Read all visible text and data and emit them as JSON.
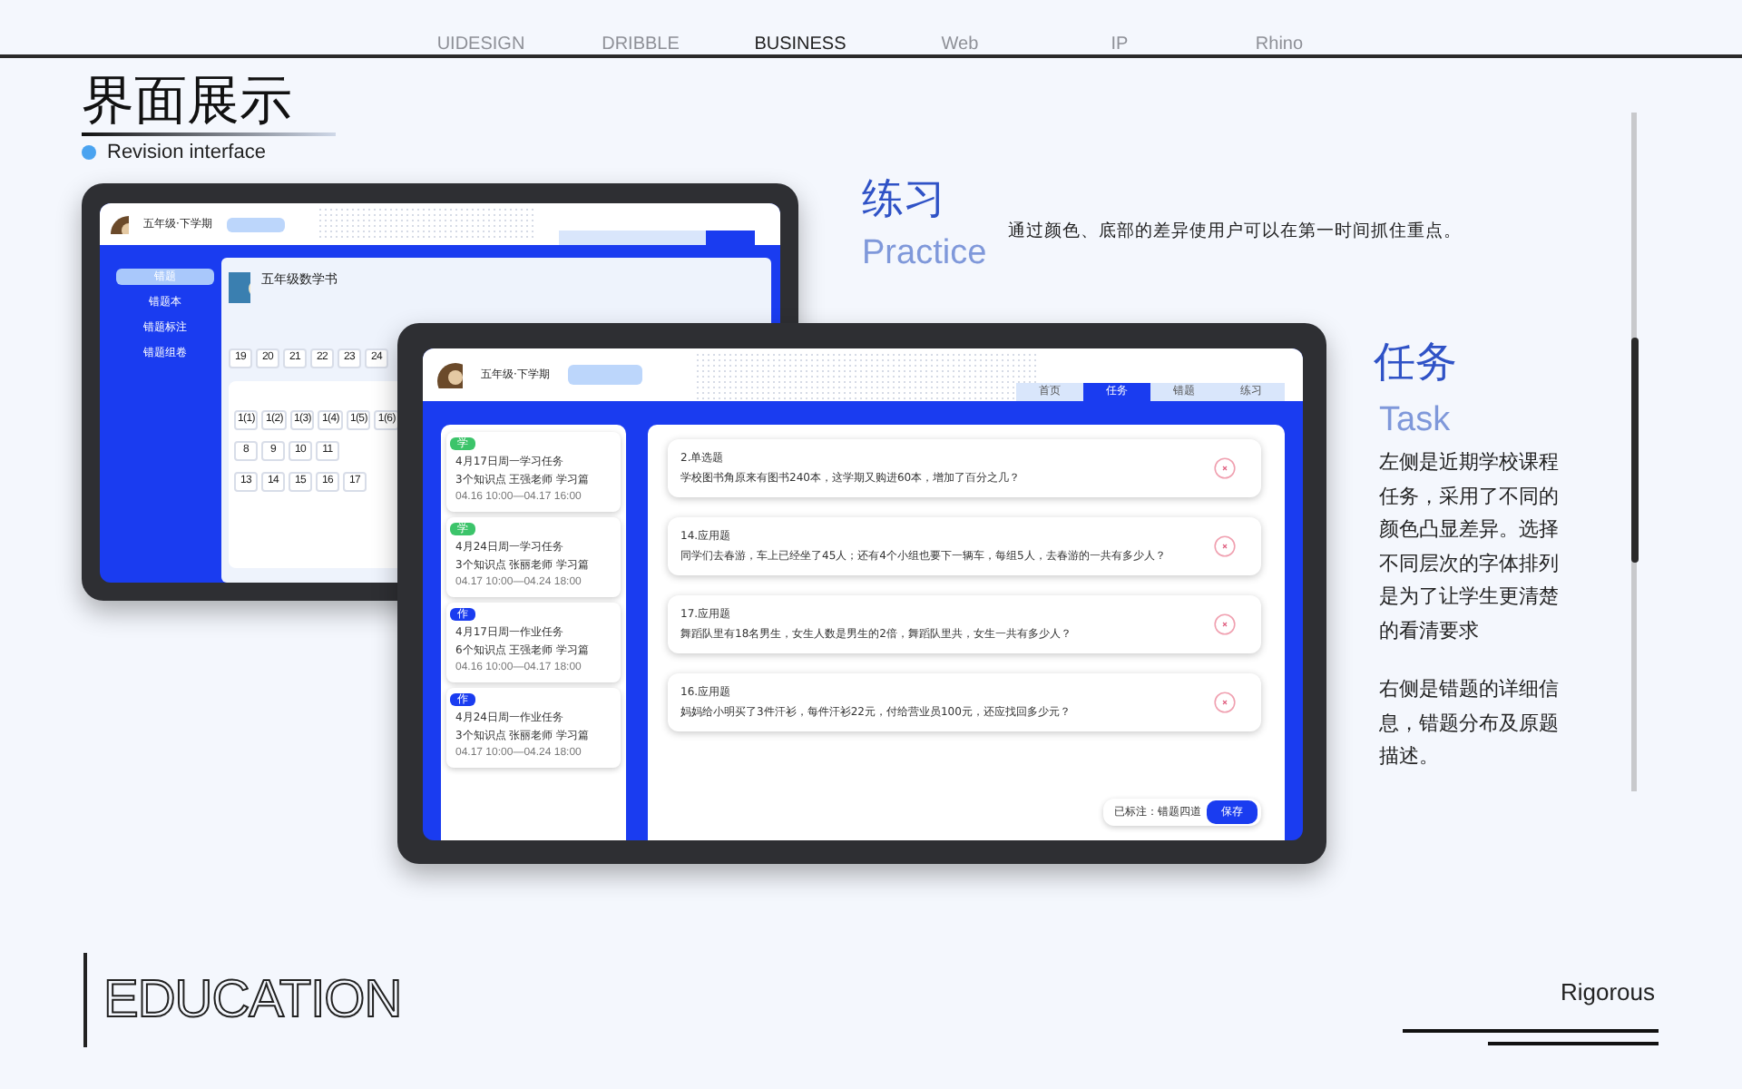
{
  "nav": [
    {
      "label": "UIDESIGN",
      "selected": false
    },
    {
      "label": "DRIBBLE",
      "selected": false
    },
    {
      "label": "BUSINESS",
      "selected": true
    },
    {
      "label": "Web",
      "selected": false
    },
    {
      "label": "IP",
      "selected": false
    },
    {
      "label": "Rhino",
      "selected": false
    }
  ],
  "title": "界面展示",
  "subtitle": "Revision interface",
  "practice": {
    "title": "练习",
    "subtitle": "Practice",
    "description": "通过颜色、底部的差异使用户可以在第一时间抓住重点。"
  },
  "task": {
    "title": "任务",
    "subtitle": "Task",
    "paragraphs": [
      "左侧是近期学校课程任务，采用了不同的颜色凸显差异。选择不同层次的字体排列是为了让学生更清楚的看清要求",
      "右侧是错题的详细信息，错题分布及原题描述。"
    ]
  },
  "back_tablet": {
    "term": "五年级·下学期",
    "sidebar": [
      {
        "label": "错题",
        "selected": true
      },
      {
        "label": "错题本",
        "selected": false
      },
      {
        "label": "错题标注",
        "selected": false
      },
      {
        "label": "错题组卷",
        "selected": false
      }
    ],
    "tabs": [
      {
        "selected": false
      },
      {
        "selected": false
      },
      {
        "selected": false
      },
      {
        "selected": true
      }
    ],
    "book_title": "五年级数学书",
    "chip_rows": [
      [
        "19",
        "20",
        "21",
        "22",
        "23",
        "24"
      ],
      [
        "1(1)",
        "1(2)",
        "1(3)",
        "1(4)",
        "1(5)",
        "1(6)"
      ],
      [
        "8",
        "9",
        "10",
        "11"
      ],
      [
        "13",
        "14",
        "15",
        "16",
        "17"
      ]
    ]
  },
  "front_tablet": {
    "term": "五年级·下学期",
    "tabs": [
      {
        "label": "首页",
        "selected": false
      },
      {
        "label": "任务",
        "selected": true
      },
      {
        "label": "错题",
        "selected": false
      },
      {
        "label": "练习",
        "selected": false
      }
    ],
    "tasks": [
      {
        "tag": "学",
        "color": "#3cc46a",
        "title": "4月17日周一学习任务",
        "meta": "3个知识点 王强老师 学习篇",
        "time": "04.16 10:00—04.17 16:00"
      },
      {
        "tag": "学",
        "color": "#3cc46a",
        "title": "4月24日周一学习任务",
        "meta": "3个知识点 张丽老师 学习篇",
        "time": "04.17 10:00—04.24 18:00"
      },
      {
        "tag": "作",
        "color": "#1a3cf0",
        "title": "4月17日周一作业任务",
        "meta": "6个知识点 王强老师 学习篇",
        "time": "04.16 10:00—04.17 18:00"
      },
      {
        "tag": "作",
        "color": "#1a3cf0",
        "title": "4月24日周一作业任务",
        "meta": "3个知识点 张丽老师 学习篇",
        "time": "04.17 10:00—04.24 18:00"
      }
    ],
    "questions": [
      {
        "type": "2.单选题",
        "text": "学校图书角原来有图书240本，这学期又购进60本，增加了百分之几？"
      },
      {
        "type": "14.应用题",
        "text": "同学们去春游，车上已经坐了45人；还有4个小组也要下一辆车，每组5人，去春游的一共有多少人？"
      },
      {
        "type": "17.应用题",
        "text": "舞蹈队里有18名男生，女生人数是男生的2倍，舞蹈队里共，女生一共有多少人？"
      },
      {
        "type": "16.应用题",
        "text": "妈妈给小明买了3件汗衫，每件汗衫22元，付给营业员100元，还应找回多少元？"
      }
    ],
    "marked": "已标注：错题四道",
    "save": "保存"
  },
  "footer": {
    "brand": "EDUCATION",
    "tagline": "Rigorous"
  }
}
